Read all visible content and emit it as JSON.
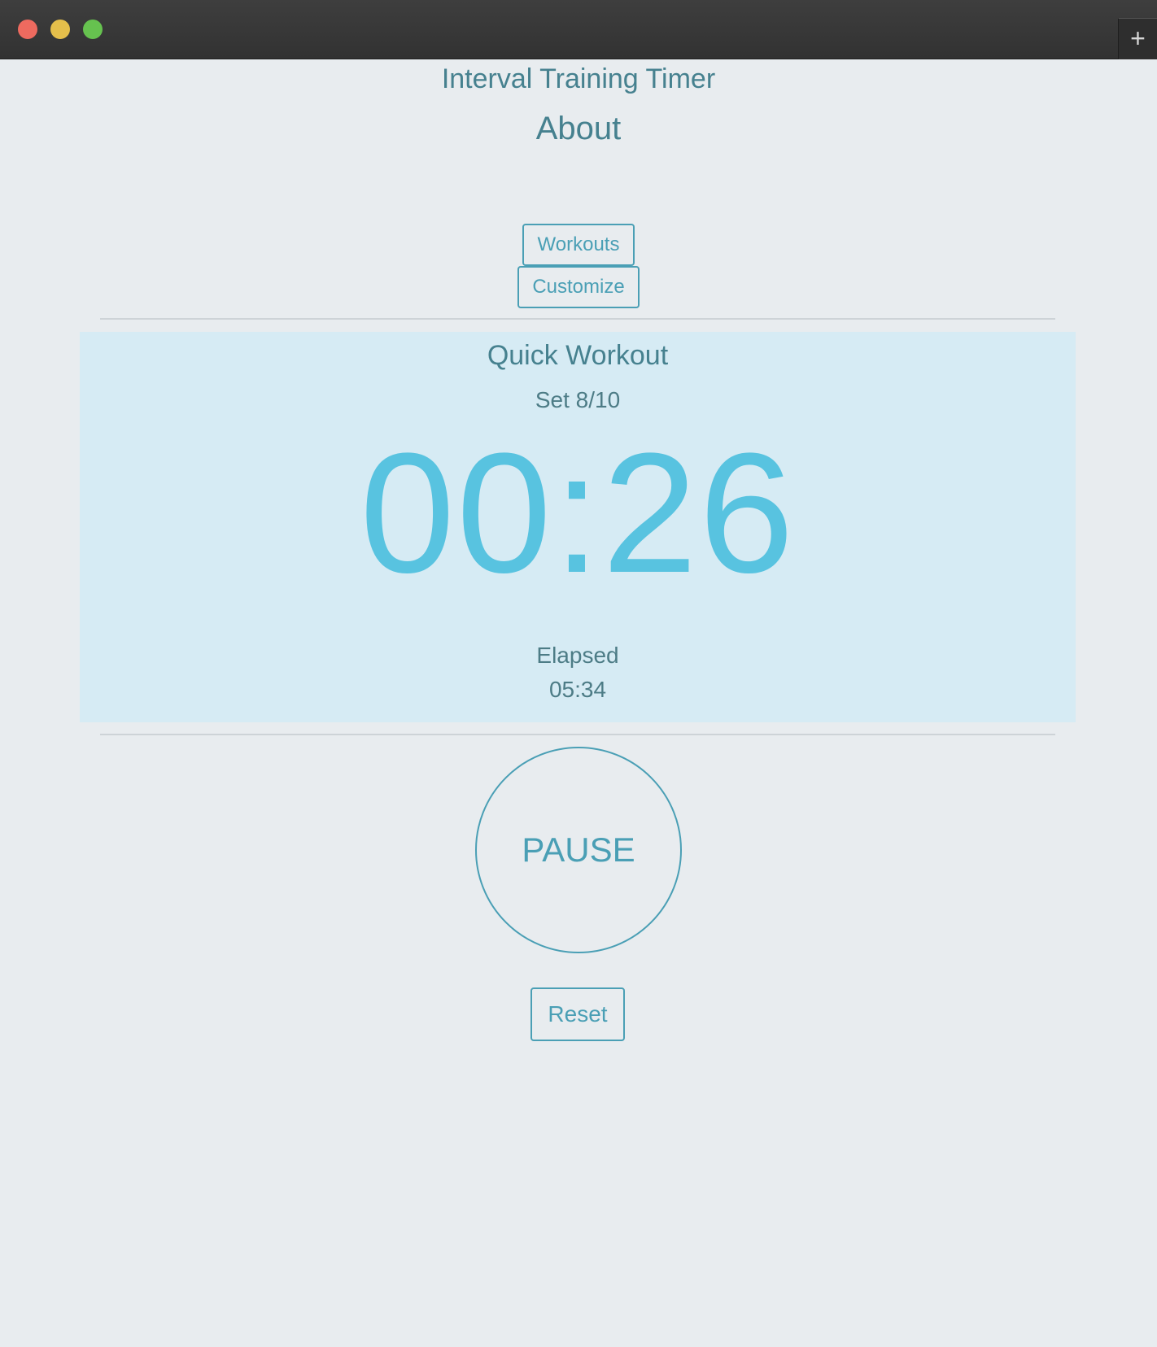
{
  "window": {
    "new_tab_label": "+"
  },
  "header": {
    "title": "Interval Training Timer",
    "about_label": "About"
  },
  "nav": {
    "workouts_label": "Workouts",
    "customize_label": "Customize"
  },
  "timer": {
    "workout_name": "Quick Workout",
    "set_info": "Set 8/10",
    "countdown": "00:26",
    "elapsed_label": "Elapsed",
    "elapsed_value": "05:34"
  },
  "controls": {
    "pause_label": "PAUSE",
    "reset_label": "Reset"
  },
  "colors": {
    "background": "#e8ecef",
    "panel": "#d6ebf4",
    "accent": "#4a9fb5",
    "countdown": "#58c3e0",
    "text": "#46818f"
  }
}
